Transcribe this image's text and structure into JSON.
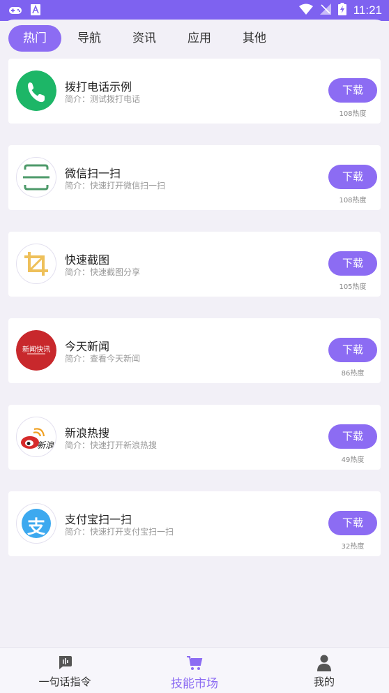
{
  "status_bar": {
    "time": "11:21"
  },
  "tabs": [
    {
      "label": "热门",
      "active": true
    },
    {
      "label": "导航",
      "active": false
    },
    {
      "label": "资讯",
      "active": false
    },
    {
      "label": "应用",
      "active": false
    },
    {
      "label": "其他",
      "active": false
    }
  ],
  "apps": [
    {
      "title": "拨打电话示例",
      "desc": "简介：测试拨打电话",
      "button": "下载",
      "heat": "108热度",
      "icon": "phone-icon"
    },
    {
      "title": "微信扫一扫",
      "desc": "简介：快速打开微信扫一扫",
      "button": "下载",
      "heat": "108热度",
      "icon": "scan-icon"
    },
    {
      "title": "快速截图",
      "desc": "简介：快速截图分享",
      "button": "下载",
      "heat": "105热度",
      "icon": "crop-icon"
    },
    {
      "title": "今天新闻",
      "desc": "简介：查看今天新闻",
      "button": "下载",
      "heat": "86热度",
      "icon": "news-icon",
      "icon_text": "新闻快讯"
    },
    {
      "title": "新浪热搜",
      "desc": "简介：快速打开新浪热搜",
      "button": "下载",
      "heat": "49热度",
      "icon": "weibo-icon",
      "icon_text": "新浪"
    },
    {
      "title": "支付宝扫一扫",
      "desc": "简介：快速打开支付宝扫一扫",
      "button": "下载",
      "heat": "32热度",
      "icon": "alipay-icon",
      "icon_text": "支"
    }
  ],
  "bottom_nav": [
    {
      "label": "一句话指令",
      "icon": "voice-command-icon",
      "active": false
    },
    {
      "label": "技能市场",
      "icon": "cart-icon",
      "active": true
    },
    {
      "label": "我的",
      "icon": "person-icon",
      "active": false
    }
  ],
  "colors": {
    "accent": "#8c6cf3",
    "status_bar": "#7e62f0",
    "background": "#f2f0f7"
  }
}
